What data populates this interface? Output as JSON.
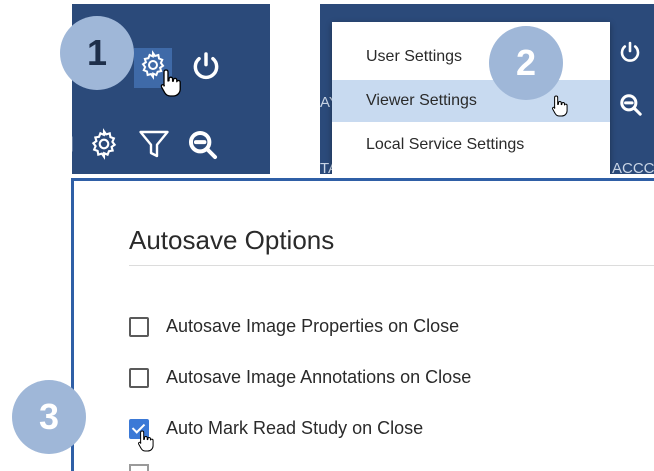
{
  "badges": {
    "step1": "1",
    "step2": "2",
    "step3": "3"
  },
  "toolbar": {
    "row1_icons": [
      "gear-icon",
      "power-icon"
    ],
    "row2_icons": [
      "gear-icon",
      "filter-icon",
      "zoom-out-icon"
    ],
    "hover_color": "#3f6aa8",
    "background_color": "#2b4a7a"
  },
  "menu": {
    "items": [
      {
        "label": "User Settings"
      },
      {
        "label": "Viewer Settings",
        "selected": true
      },
      {
        "label": "Local Service Settings"
      }
    ],
    "fragments": {
      "left_top": "AY",
      "bottom_left": "TA",
      "bottom_right": "ACCC"
    },
    "highlight_color": "#c8daf0"
  },
  "dialog": {
    "title": "Autosave Options",
    "options": [
      {
        "label": "Autosave Image Properties on Close",
        "checked": false
      },
      {
        "label": "Autosave Image Annotations on Close",
        "checked": false
      },
      {
        "label": "Auto Mark Read Study on Close",
        "checked": true
      }
    ],
    "accent_color": "#3b79d6",
    "border_color": "#2f5fa6"
  }
}
